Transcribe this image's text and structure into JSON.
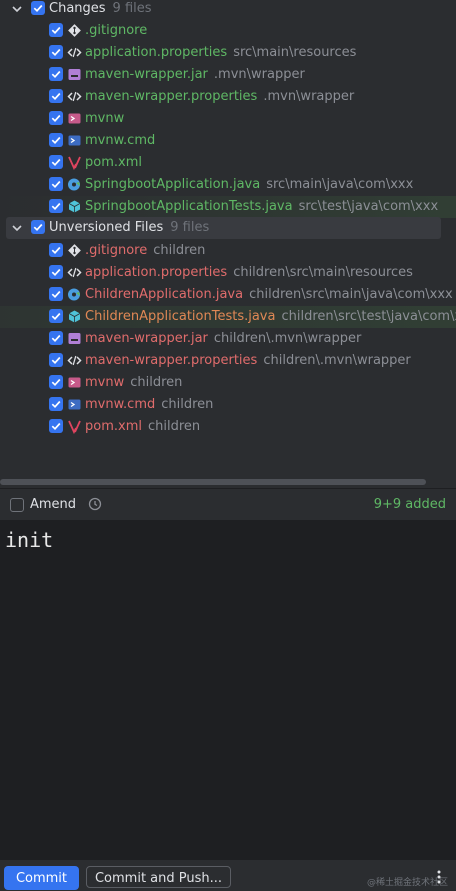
{
  "changes": {
    "title": "Changes",
    "count": "9 files",
    "files": [
      {
        "name": ".gitignore",
        "path": "",
        "icon": "git-ignore-icon"
      },
      {
        "name": "application.properties",
        "path": "src\\main\\resources",
        "icon": "properties-icon"
      },
      {
        "name": "maven-wrapper.jar",
        "path": ".mvn\\wrapper",
        "icon": "jar-icon"
      },
      {
        "name": "maven-wrapper.properties",
        "path": ".mvn\\wrapper",
        "icon": "properties-icon"
      },
      {
        "name": "mvnw",
        "path": "",
        "icon": "shell-script-icon"
      },
      {
        "name": "mvnw.cmd",
        "path": "",
        "icon": "cmd-script-icon"
      },
      {
        "name": "pom.xml",
        "path": "",
        "icon": "maven-icon"
      },
      {
        "name": "SpringbootApplication.java",
        "path": "src\\main\\java\\com\\xxx",
        "icon": "spring-class-icon"
      },
      {
        "name": "SpringbootApplicationTests.java",
        "path": "src\\test\\java\\com\\xxx",
        "icon": "test-class-icon"
      }
    ]
  },
  "unversioned": {
    "title": "Unversioned Files",
    "count": "9 files",
    "files": [
      {
        "name": ".gitignore",
        "path": "children",
        "icon": "git-ignore-icon"
      },
      {
        "name": "application.properties",
        "path": "children\\src\\main\\resources",
        "icon": "properties-icon"
      },
      {
        "name": "ChildrenApplication.java",
        "path": "children\\src\\main\\java\\com\\xxx",
        "icon": "spring-class-icon"
      },
      {
        "name": "ChildrenApplicationTests.java",
        "path": "children\\src\\test\\java\\com\\x:",
        "icon": "test-class-icon"
      },
      {
        "name": "maven-wrapper.jar",
        "path": "children\\.mvn\\wrapper",
        "icon": "jar-icon"
      },
      {
        "name": "maven-wrapper.properties",
        "path": "children\\.mvn\\wrapper",
        "icon": "properties-icon"
      },
      {
        "name": "mvnw",
        "path": "children",
        "icon": "shell-script-icon"
      },
      {
        "name": "mvnw.cmd",
        "path": "children",
        "icon": "cmd-script-icon"
      },
      {
        "name": "pom.xml",
        "path": "children",
        "icon": "maven-icon"
      }
    ]
  },
  "amend": {
    "label": "Amend",
    "checked": false,
    "added": "9+9 added"
  },
  "message": {
    "text": "init"
  },
  "buttons": {
    "commit": "Commit",
    "commit_push": "Commit and Push..."
  },
  "watermark": "@稀土掘金技术社区",
  "colors": {
    "accent": "#3574f0",
    "background": "#2b2d30",
    "editor_background": "#1e1f22",
    "added_green": "#5fb865",
    "unversioned_red": "#e06c6c"
  }
}
